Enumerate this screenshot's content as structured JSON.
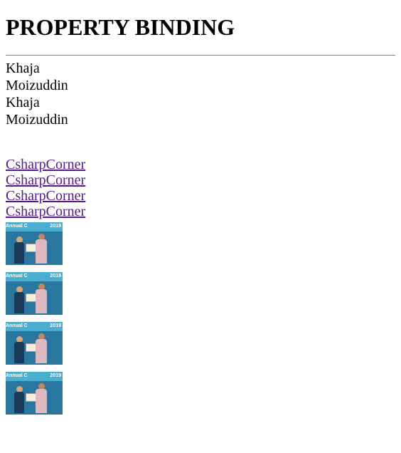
{
  "heading": "PROPERTY BINDING",
  "names": [
    "Khaja",
    "Moizuddin",
    "Khaja",
    "Moizuddin"
  ],
  "links": [
    {
      "text": "CsharpCorner",
      "href": "#"
    },
    {
      "text": "CsharpCorner",
      "href": "#"
    },
    {
      "text": "CsharpCorner",
      "href": "#"
    },
    {
      "text": "CsharpCorner",
      "href": "#"
    }
  ],
  "image_count": 4,
  "image_banner_left": "Annual C",
  "image_banner_right": "2019"
}
